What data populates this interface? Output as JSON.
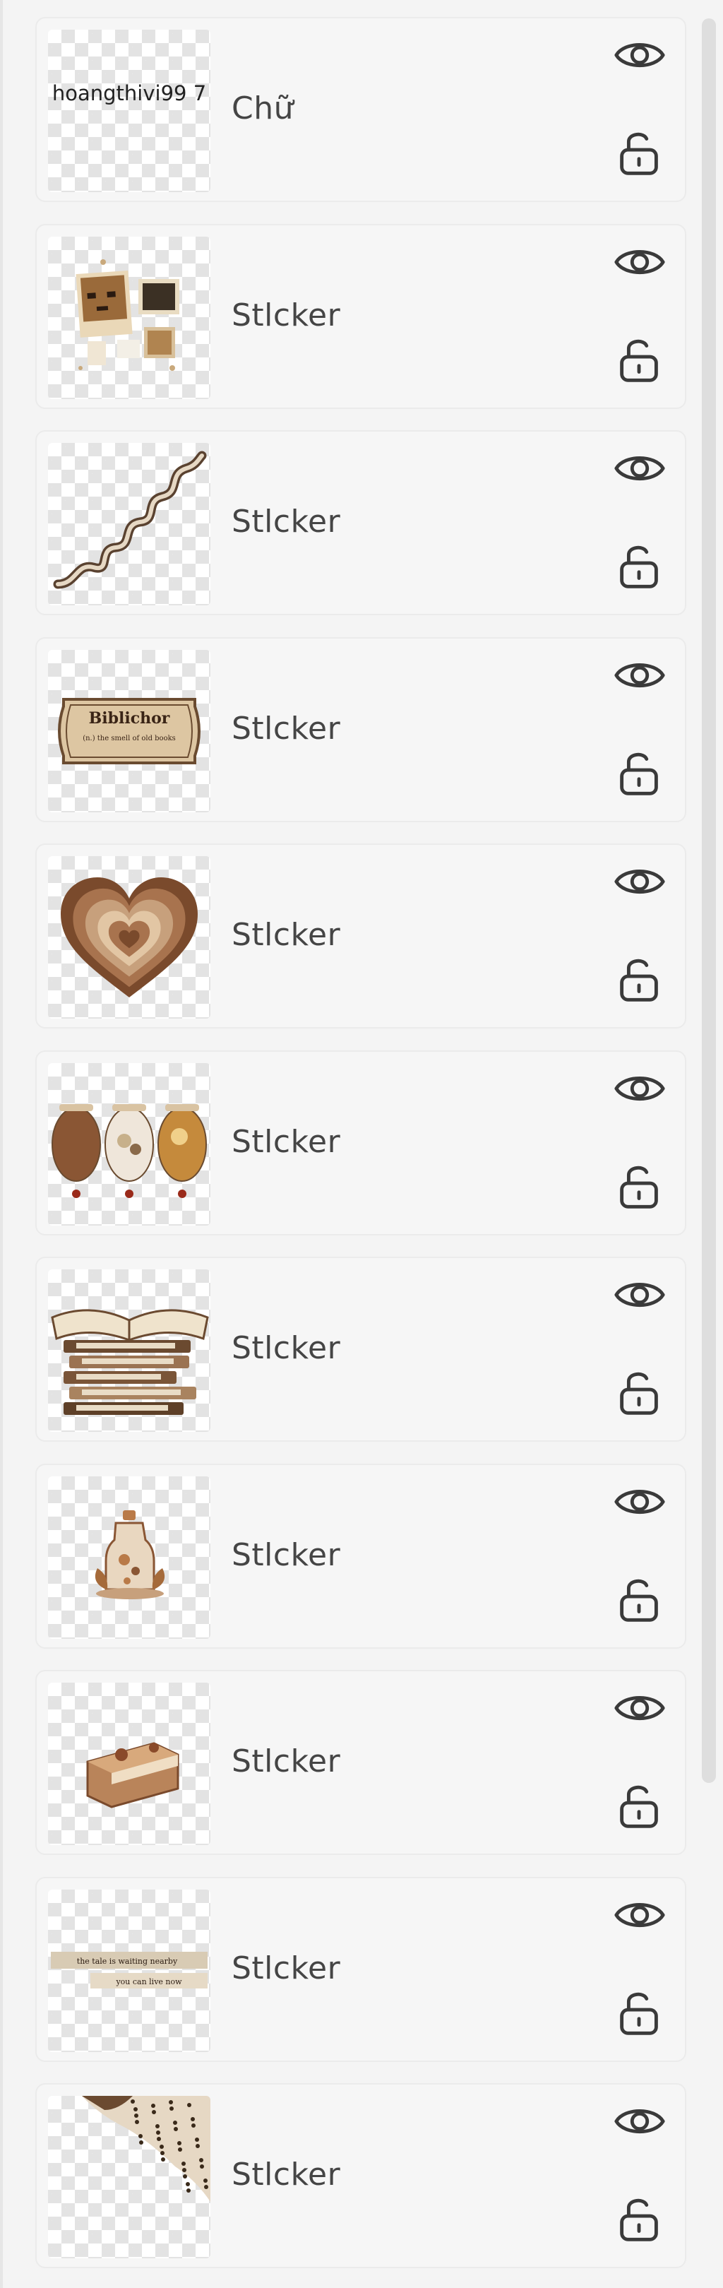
{
  "layers": [
    {
      "label": "Chữ",
      "thumb_text": "hoangthivi99 7",
      "art": "text"
    },
    {
      "label": "Stlcker",
      "art": "photos"
    },
    {
      "label": "Stlcker",
      "art": "wave"
    },
    {
      "label": "Stlcker",
      "art": "ticket",
      "art_text_1": "Biblichor",
      "art_text_2": "(n.) the smell of old books"
    },
    {
      "label": "Stlcker",
      "art": "heart"
    },
    {
      "label": "Stlcker",
      "art": "jars"
    },
    {
      "label": "Stlcker",
      "art": "books"
    },
    {
      "label": "Stlcker",
      "art": "bottle"
    },
    {
      "label": "Stlcker",
      "art": "cake"
    },
    {
      "label": "Stlcker",
      "art": "strips"
    },
    {
      "label": "Stlcker",
      "art": "corner"
    }
  ],
  "icons": {
    "visibility": "eye-icon",
    "lock": "unlock-icon"
  },
  "colors": {
    "panel_bg": "#f4f4f4",
    "row_bg": "#f6f6f6",
    "label_text": "#454545",
    "icon_stroke": "#3a3a3a",
    "scrollbar": "#dedede"
  }
}
